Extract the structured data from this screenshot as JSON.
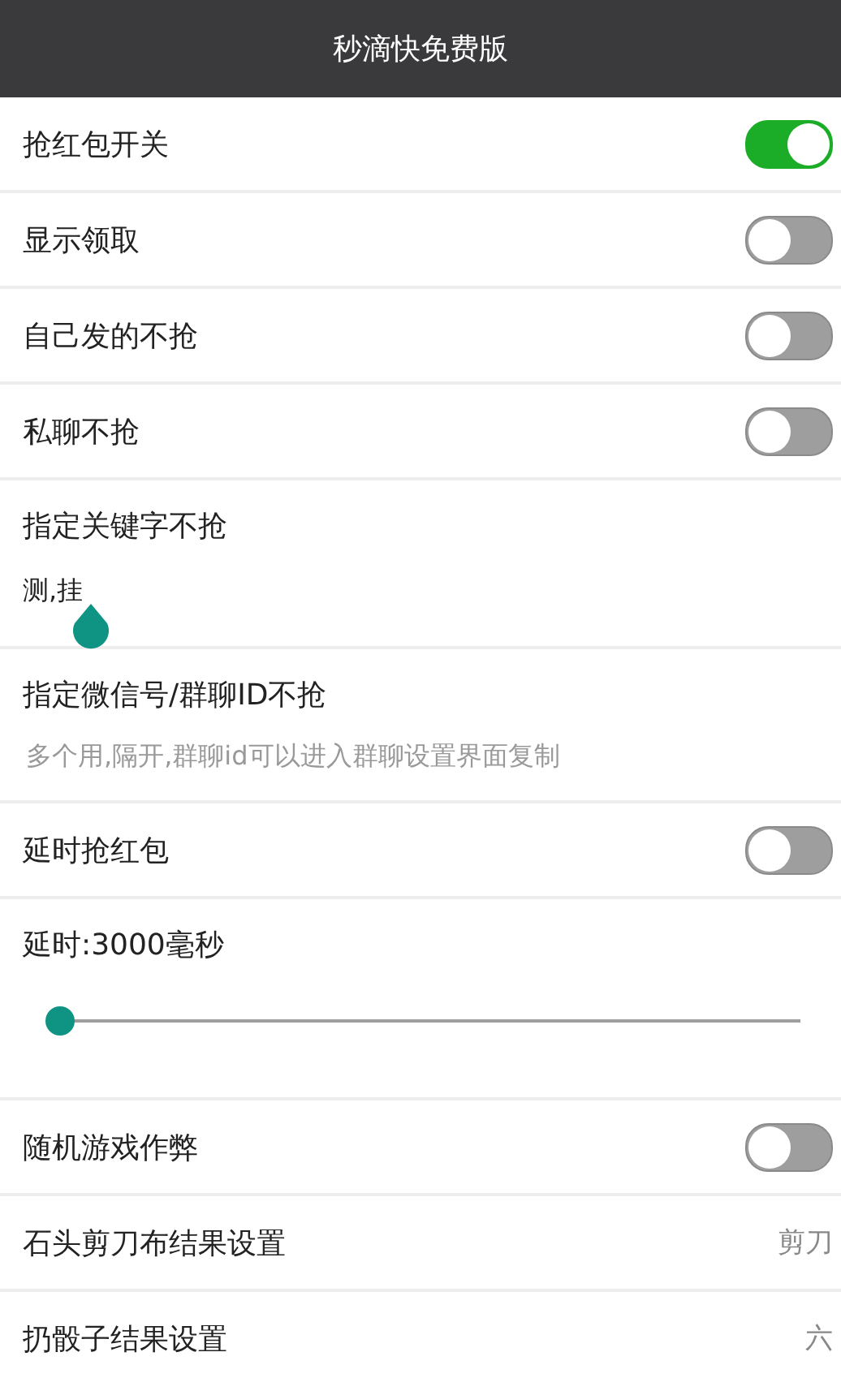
{
  "header": {
    "title": "秒滴快免费版"
  },
  "settings": [
    {
      "kind": "toggle",
      "label": "抢红包开关",
      "on": true
    },
    {
      "kind": "toggle",
      "label": "显示领取",
      "on": false
    },
    {
      "kind": "toggle",
      "label": "自己发的不抢",
      "on": false
    },
    {
      "kind": "toggle",
      "label": "私聊不抢",
      "on": false
    },
    {
      "kind": "input",
      "label": "指定关键字不抢",
      "value": "测,挂"
    },
    {
      "kind": "hint",
      "label": "指定微信号/群聊ID不抢",
      "placeholder": "多个用,隔开,群聊id可以进入群聊设置界面复制"
    },
    {
      "kind": "toggle",
      "label": "延时抢红包",
      "on": false
    },
    {
      "kind": "slider",
      "label": "延时:3000毫秒",
      "level": 0
    },
    {
      "kind": "toggle",
      "label": "随机游戏作弊",
      "on": false
    },
    {
      "kind": "value",
      "label": "石头剪刀布结果设置",
      "value": "剪刀"
    },
    {
      "kind": "value",
      "label": "扔骰子结果设置",
      "value": "六"
    }
  ]
}
